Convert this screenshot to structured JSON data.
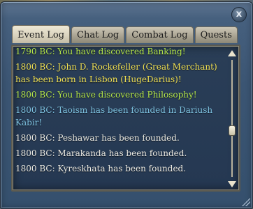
{
  "window": {
    "close_label": "x"
  },
  "tabs": [
    {
      "label": "Event Log",
      "active": true
    },
    {
      "label": "Chat Log",
      "active": false
    },
    {
      "label": "Combat Log",
      "active": false
    },
    {
      "label": "Quests",
      "active": false
    }
  ],
  "log": {
    "entries": [
      {
        "text": "1790 BC: You have discovered Banking!",
        "color": "#b6e84b"
      },
      {
        "text": "1800 BC: John D. Rockefeller (Great Merchant) has been born in Lisbon (HugeDarius)!",
        "color": "#f2e255"
      },
      {
        "text": "1800 BC: You have discovered Philosophy!",
        "color": "#b6e84b"
      },
      {
        "text": "1800 BC: Taoism has been founded in Dariush Kabir!",
        "color": "#7fc4e3"
      },
      {
        "text": "1800 BC: Peshawar has been founded.",
        "color": "#ecebe4"
      },
      {
        "text": "1800 BC: Marakanda has been founded.",
        "color": "#ecebe4"
      },
      {
        "text": "1800 BC: Kyreskhata has been founded.",
        "color": "#ecebe4"
      }
    ]
  }
}
